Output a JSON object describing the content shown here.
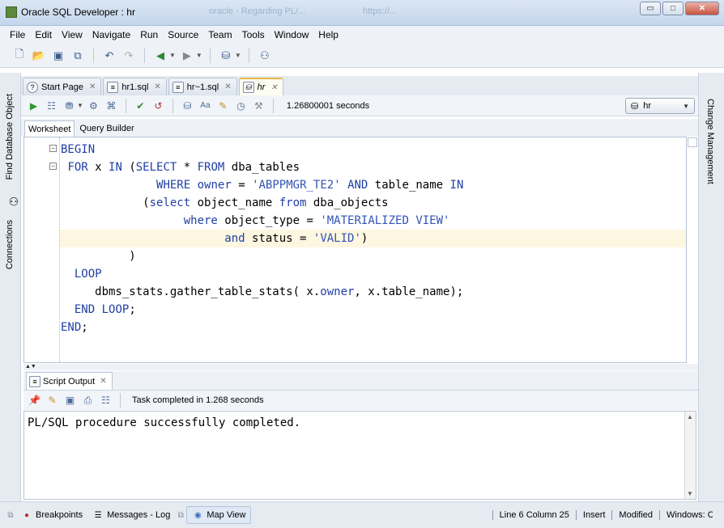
{
  "window": {
    "title": "Oracle SQL Developer : hr",
    "background_tabs": [
      "oracle - Regarding PL/...",
      "https://..."
    ],
    "minimize": "▭",
    "maximize": "□",
    "close": "✕"
  },
  "menu": [
    "File",
    "Edit",
    "View",
    "Navigate",
    "Run",
    "Source",
    "Team",
    "Tools",
    "Window",
    "Help"
  ],
  "side": {
    "left_labels": [
      "Find Database Object",
      "Connections"
    ],
    "right_label": "Change Management"
  },
  "tabs": [
    {
      "label": "Start Page",
      "icon": "help-icon"
    },
    {
      "label": "hr1.sql",
      "icon": "sql-file-icon"
    },
    {
      "label": "hr~1.sql",
      "icon": "sql-file-icon"
    },
    {
      "label": "hr",
      "icon": "worksheet-icon",
      "active": true
    }
  ],
  "worksheet": {
    "exec_time": "1.26800001 seconds",
    "connection": "hr",
    "subtabs": [
      "Worksheet",
      "Query Builder"
    ]
  },
  "code": [
    "BEGIN",
    " FOR x IN (SELECT * FROM dba_tables",
    "              WHERE owner = 'ABPPMGR_TE2' AND table_name IN",
    "            (select object_name from dba_objects",
    "                  where object_type = 'MATERIALIZED VIEW'",
    "                        and status = 'VALID')",
    "          )",
    "  LOOP",
    "     dbms_stats.gather_table_stats( x.owner, x.table_name);",
    "  END LOOP;",
    "END;"
  ],
  "highlighted_line": 6,
  "output": {
    "tab_label": "Script Output",
    "message": "Task completed in 1.268 seconds",
    "text": "PL/SQL procedure successfully completed."
  },
  "status": {
    "tabs": [
      "Breakpoints",
      "Messages - Log",
      "Map View"
    ],
    "position": "Line 6 Column 25",
    "mode": "Insert",
    "modified": "Modified",
    "eol": "Windows: CR"
  }
}
